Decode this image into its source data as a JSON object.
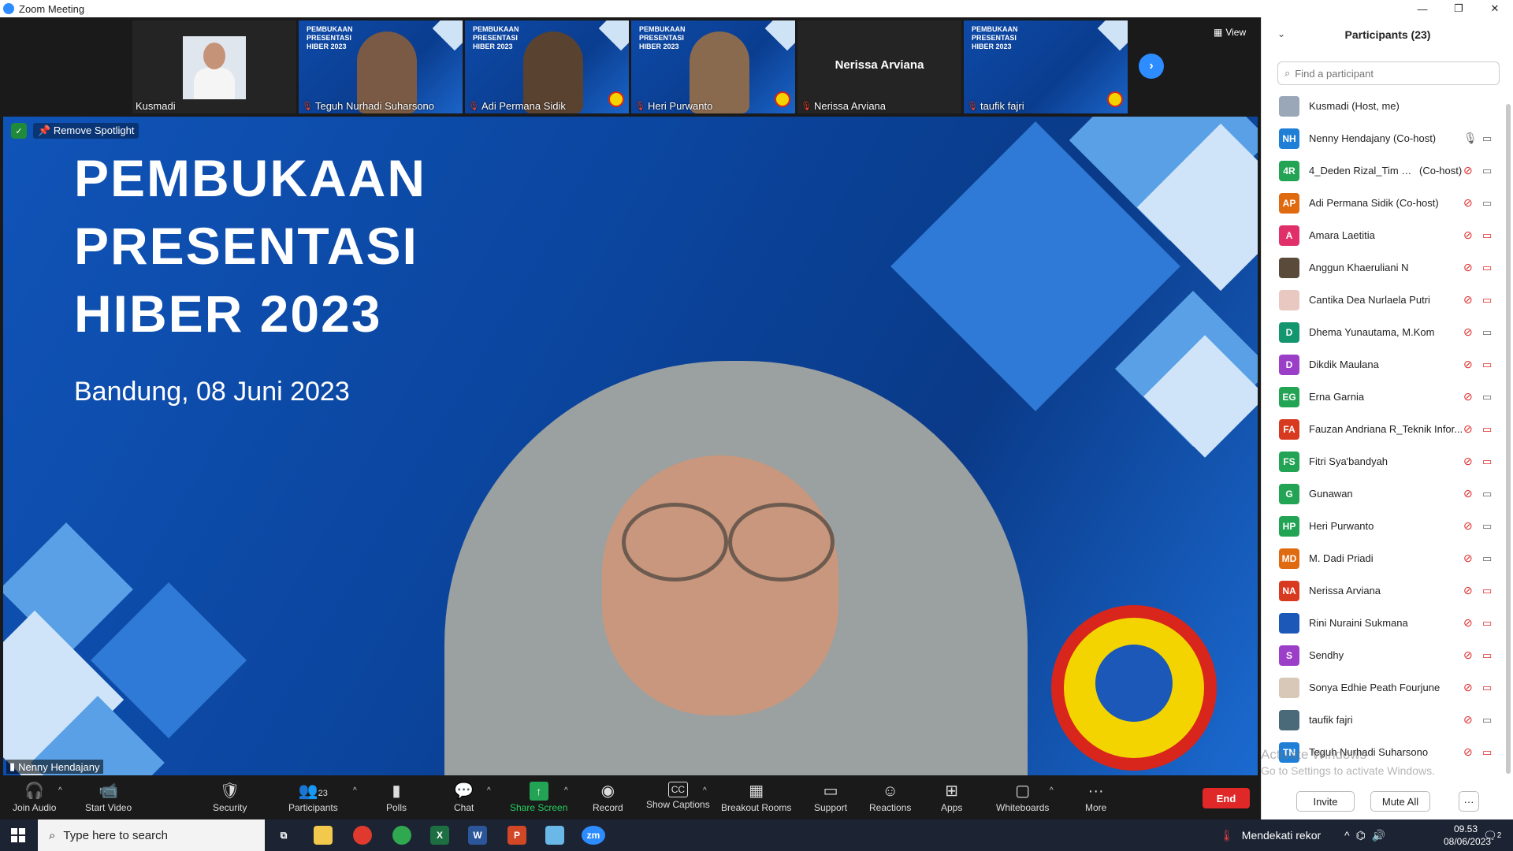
{
  "window": {
    "title": "Zoom Meeting",
    "minimize": "—",
    "maximize": "❐",
    "close": "✕"
  },
  "gallery": {
    "view_label": "View",
    "tiles": [
      {
        "name": "Kusmadi",
        "muted": false
      },
      {
        "name": "Teguh Nurhadi Suharsono",
        "muted": true,
        "slide": "PEMBUKAAN\nPRESENTASI\nHIBER 2023"
      },
      {
        "name": "Adi Permana Sidik",
        "muted": true,
        "slide": "PEMBUKAAN\nPRESENTASI\nHIBER 2023"
      },
      {
        "name": "Heri Purwanto",
        "muted": true,
        "slide": "PEMBUKAAN\nPRESENTASI\nHIBER 2023"
      },
      {
        "name": "Nerissa Arviana",
        "muted": true,
        "display_name": "Nerissa Arviana"
      },
      {
        "name": "taufik fajri",
        "muted": true,
        "slide": "PEMBUKAAN\nPRESENTASI\nHIBER 2023"
      }
    ]
  },
  "main": {
    "spotlight_label": "Remove Spotlight",
    "slide_line1": "PEMBUKAAN",
    "slide_line2": "PRESENTASI",
    "slide_line3": "HIBER 2023",
    "slide_date": "Bandung, 08 Juni 2023",
    "speaker_name": "Nenny Hendajany"
  },
  "toolbar": {
    "join_audio": "Join Audio",
    "start_video": "Start Video",
    "security": "Security",
    "participants": "Participants",
    "participants_count": "23",
    "polls": "Polls",
    "chat": "Chat",
    "share_screen": "Share Screen",
    "record": "Record",
    "show_captions": "Show Captions",
    "breakout_rooms": "Breakout Rooms",
    "support": "Support",
    "reactions": "Reactions",
    "apps": "Apps",
    "whiteboards": "Whiteboards",
    "more": "More",
    "end": "End"
  },
  "participants_panel": {
    "title": "Participants (23)",
    "search_placeholder": "Find a participant",
    "invite": "Invite",
    "mute_all": "Mute All",
    "more": "···",
    "list": [
      {
        "initials": "",
        "name": "Kusmadi (Host, me)",
        "color": "#9aa7b8",
        "mic": "none",
        "cam": "none"
      },
      {
        "initials": "NH",
        "name": "Nenny Hendajany (Co-host)",
        "color": "#1f7fd6",
        "mic": "on",
        "cam": "on"
      },
      {
        "initials": "4R",
        "name": "4_Deden Rizal_Tim P...",
        "cohost": "(Co-host)",
        "color": "#23a455",
        "mic": "muted",
        "cam": "on"
      },
      {
        "initials": "AP",
        "name": "Adi Permana Sidik (Co-host)",
        "color": "#e06a10",
        "mic": "muted",
        "cam": "on"
      },
      {
        "initials": "A",
        "name": "Amara Laetitia",
        "color": "#e0306a",
        "mic": "muted",
        "cam": "muted"
      },
      {
        "initials": "",
        "name": "Anggun Khaeruliani N",
        "color": "#5a4a3a",
        "mic": "muted",
        "cam": "muted"
      },
      {
        "initials": "",
        "name": "Cantika Dea Nurlaela Putri",
        "color": "#e8c8c0",
        "mic": "muted",
        "cam": "muted"
      },
      {
        "initials": "D",
        "name": "Dhema Yunautama, M.Kom",
        "color": "#13956e",
        "mic": "muted",
        "cam": "on"
      },
      {
        "initials": "D",
        "name": "Dikdik Maulana",
        "color": "#9b3fc8",
        "mic": "muted",
        "cam": "muted"
      },
      {
        "initials": "EG",
        "name": "Erna Garnia",
        "color": "#23a455",
        "mic": "muted",
        "cam": "on"
      },
      {
        "initials": "FA",
        "name": "Fauzan Andriana R_Teknik Infor...",
        "color": "#d83a20",
        "mic": "muted",
        "cam": "muted"
      },
      {
        "initials": "FS",
        "name": "Fitri Sya'bandyah",
        "color": "#23a455",
        "mic": "muted",
        "cam": "muted"
      },
      {
        "initials": "G",
        "name": "Gunawan",
        "color": "#23a455",
        "mic": "muted",
        "cam": "on"
      },
      {
        "initials": "HP",
        "name": "Heri Purwanto",
        "color": "#23a455",
        "mic": "muted",
        "cam": "on"
      },
      {
        "initials": "MD",
        "name": "M. Dadi Priadi",
        "color": "#e06a10",
        "mic": "muted",
        "cam": "on"
      },
      {
        "initials": "NA",
        "name": "Nerissa Arviana",
        "color": "#d83a20",
        "mic": "muted",
        "cam": "muted"
      },
      {
        "initials": "",
        "name": "Rini Nuraini Sukmana",
        "color": "#1b58b8",
        "mic": "muted",
        "cam": "muted"
      },
      {
        "initials": "S",
        "name": "Sendhy",
        "color": "#9b3fc8",
        "mic": "muted",
        "cam": "muted"
      },
      {
        "initials": "",
        "name": "Sonya Edhie Peath Fourjune",
        "color": "#d8c8b8",
        "mic": "muted",
        "cam": "muted"
      },
      {
        "initials": "",
        "name": "taufik fajri",
        "color": "#4a6a7a",
        "mic": "muted",
        "cam": "on"
      },
      {
        "initials": "TN",
        "name": "Teguh Nurhadi Suharsono",
        "color": "#1f7fd6",
        "mic": "muted",
        "cam": "muted"
      }
    ]
  },
  "watermark": {
    "line1": "Activate Windows",
    "line2": "Go to Settings to activate Windows."
  },
  "taskbar": {
    "search_placeholder": "Type here to search",
    "weather": "Mendekati rekor",
    "time": "09.53",
    "date": "08/06/2023",
    "notif_count": "2"
  }
}
